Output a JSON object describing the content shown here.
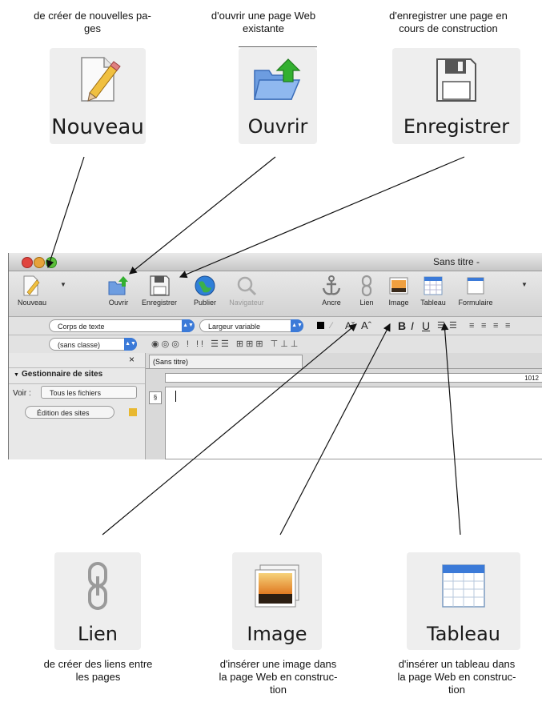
{
  "captions": {
    "nouveau": "de créer de nouvelles pa-\nges",
    "ouvrir": "d'ouvrir une page Web\nexistante",
    "enregistrer": "d'enregistrer une page en\ncours de construction",
    "lien": "de créer des liens entre\nles pages",
    "image": "d'insérer une image dans\nla page Web en construc-\ntion",
    "tableau": "d'insérer un tableau dans\nla page Web en construc-\ntion"
  },
  "callouts": {
    "nouveau": "Nouveau",
    "ouvrir": "Ouvrir",
    "enregistrer": "Enregistrer",
    "lien": "Lien",
    "image": "Image",
    "tableau": "Tableau"
  },
  "window": {
    "title": "Sans titre -"
  },
  "toolbar": {
    "nouveau": "Nouveau",
    "ouvrir": "Ouvrir",
    "enregistrer": "Enregistrer",
    "publier": "Publier",
    "navigateur": "Navigateur",
    "ancre": "Ancre",
    "lien": "Lien",
    "image": "Image",
    "tableau": "Tableau",
    "formulaire": "Formulaire"
  },
  "format": {
    "paragraph_style": "Corps de texte",
    "font": "Largeur variable",
    "class": "(sans classe)"
  },
  "sidebar": {
    "close": "×",
    "section_title": "Gestionnaire de sites",
    "voir_label": "Voir :",
    "voir_value": "Tous les fichiers",
    "edit_sites": "Édition des sites"
  },
  "document": {
    "tab": "(Sans titre)",
    "ruler_value": "1012"
  },
  "colors": {
    "close": "#e0443e",
    "minimize": "#e6a23a",
    "zoom": "#5cbf3b",
    "accent": "#3b7ad8",
    "arrow": "#111111"
  }
}
